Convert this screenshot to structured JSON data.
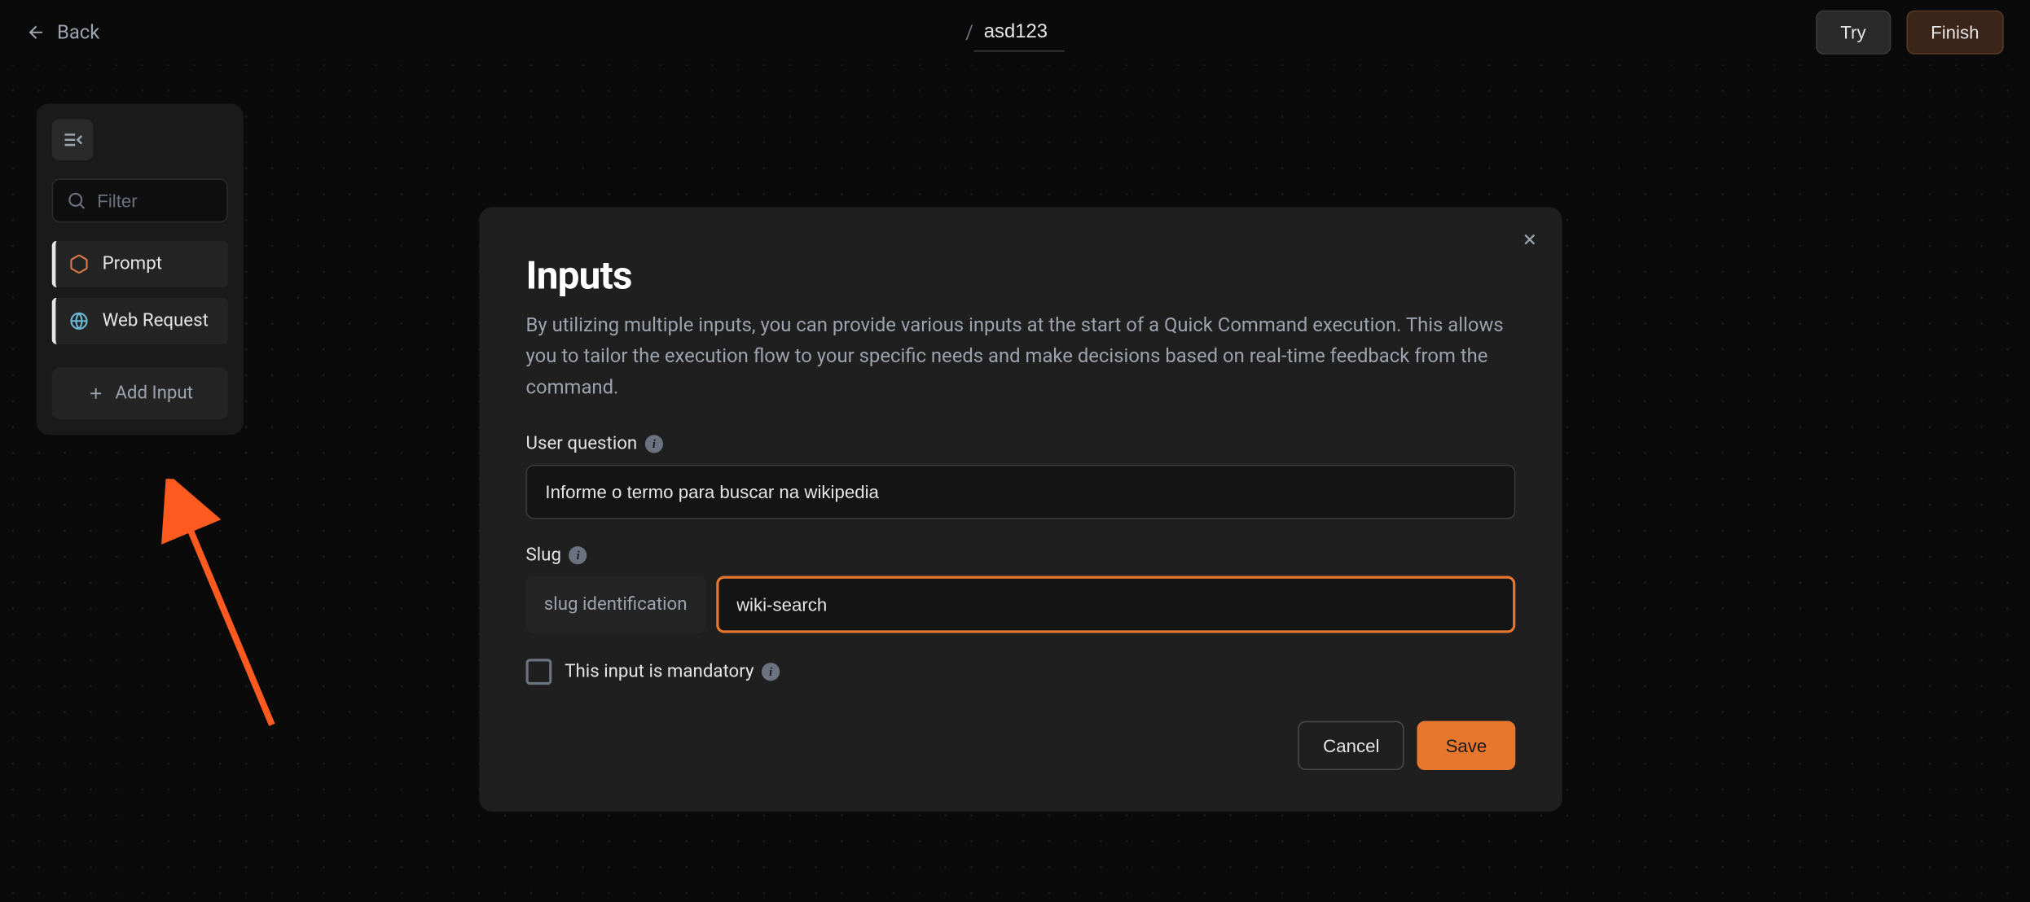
{
  "header": {
    "back_label": "Back",
    "breadcrumb_slash": "/",
    "title_value": "asd123",
    "try_label": "Try",
    "finish_label": "Finish"
  },
  "sidebar": {
    "filter_placeholder": "Filter",
    "items": [
      {
        "label": "Prompt",
        "icon": "hexagon-icon"
      },
      {
        "label": "Web Request",
        "icon": "globe-icon"
      }
    ],
    "add_input_label": "Add Input"
  },
  "modal": {
    "title": "Inputs",
    "description": "By utilizing multiple inputs, you can provide various inputs at the start of a Quick Command execution. This allows you to tailor the execution flow to your specific needs and make decisions based on real-time feedback from the command.",
    "user_question_label": "User question",
    "user_question_value": "Informe o termo para buscar na wikipedia",
    "slug_label": "Slug",
    "slug_prefix_label": "slug identification",
    "slug_value": "wiki-search",
    "mandatory_label": "This input is mandatory",
    "mandatory_checked": false,
    "cancel_label": "Cancel",
    "save_label": "Save"
  },
  "colors": {
    "accent": "#e8772e",
    "bg": "#0a0a0a",
    "panel": "#1f1f1f"
  }
}
